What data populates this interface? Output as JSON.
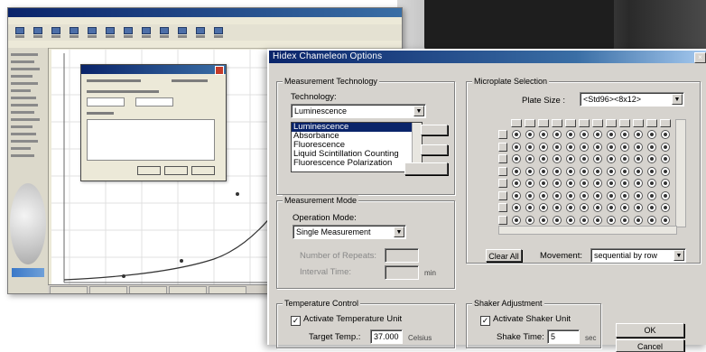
{
  "colors": {
    "titlebar": "#0a246a",
    "dialog_bg": "#d6d3ce",
    "selection": "#0a246a"
  },
  "dialog": {
    "title": "Hidex Chameleon Options",
    "measurement": {
      "group_label": "Measurement Technology",
      "technology_label": "Technology:",
      "technology_value": "Luminescence",
      "options": [
        "Luminescence",
        "Absorbance",
        "Fluorescence",
        "Liquid Scintillation Counting",
        "Fluorescence Polarization"
      ],
      "selected_index": 0
    },
    "mode": {
      "group_label": "Measurement Mode",
      "operation_label": "Operation Mode:",
      "operation_value": "Single Measurement",
      "repeats_label": "Number of Repeats:",
      "interval_label": "Interval Time:",
      "interval_unit": "min"
    },
    "microplate": {
      "group_label": "Microplate Selection",
      "plate_size_label": "Plate Size :",
      "plate_size_value": "<Std96><8x12>",
      "clear_all_label": "Clear All",
      "movement_label": "Movement:",
      "movement_value": "sequential by row"
    },
    "temperature": {
      "group_label": "Temperature Control",
      "activate_label": "Activate Temperature Unit",
      "target_label": "Target Temp.:",
      "target_value": "37.000",
      "target_unit": "Celsius"
    },
    "shaker": {
      "group_label": "Shaker Adjustment",
      "activate_label": "Activate Shaker Unit",
      "time_label": "Shake Time:",
      "time_value": "5",
      "time_unit": "sec"
    },
    "buttons": {
      "ok": "OK",
      "cancel": "Cancel"
    }
  }
}
